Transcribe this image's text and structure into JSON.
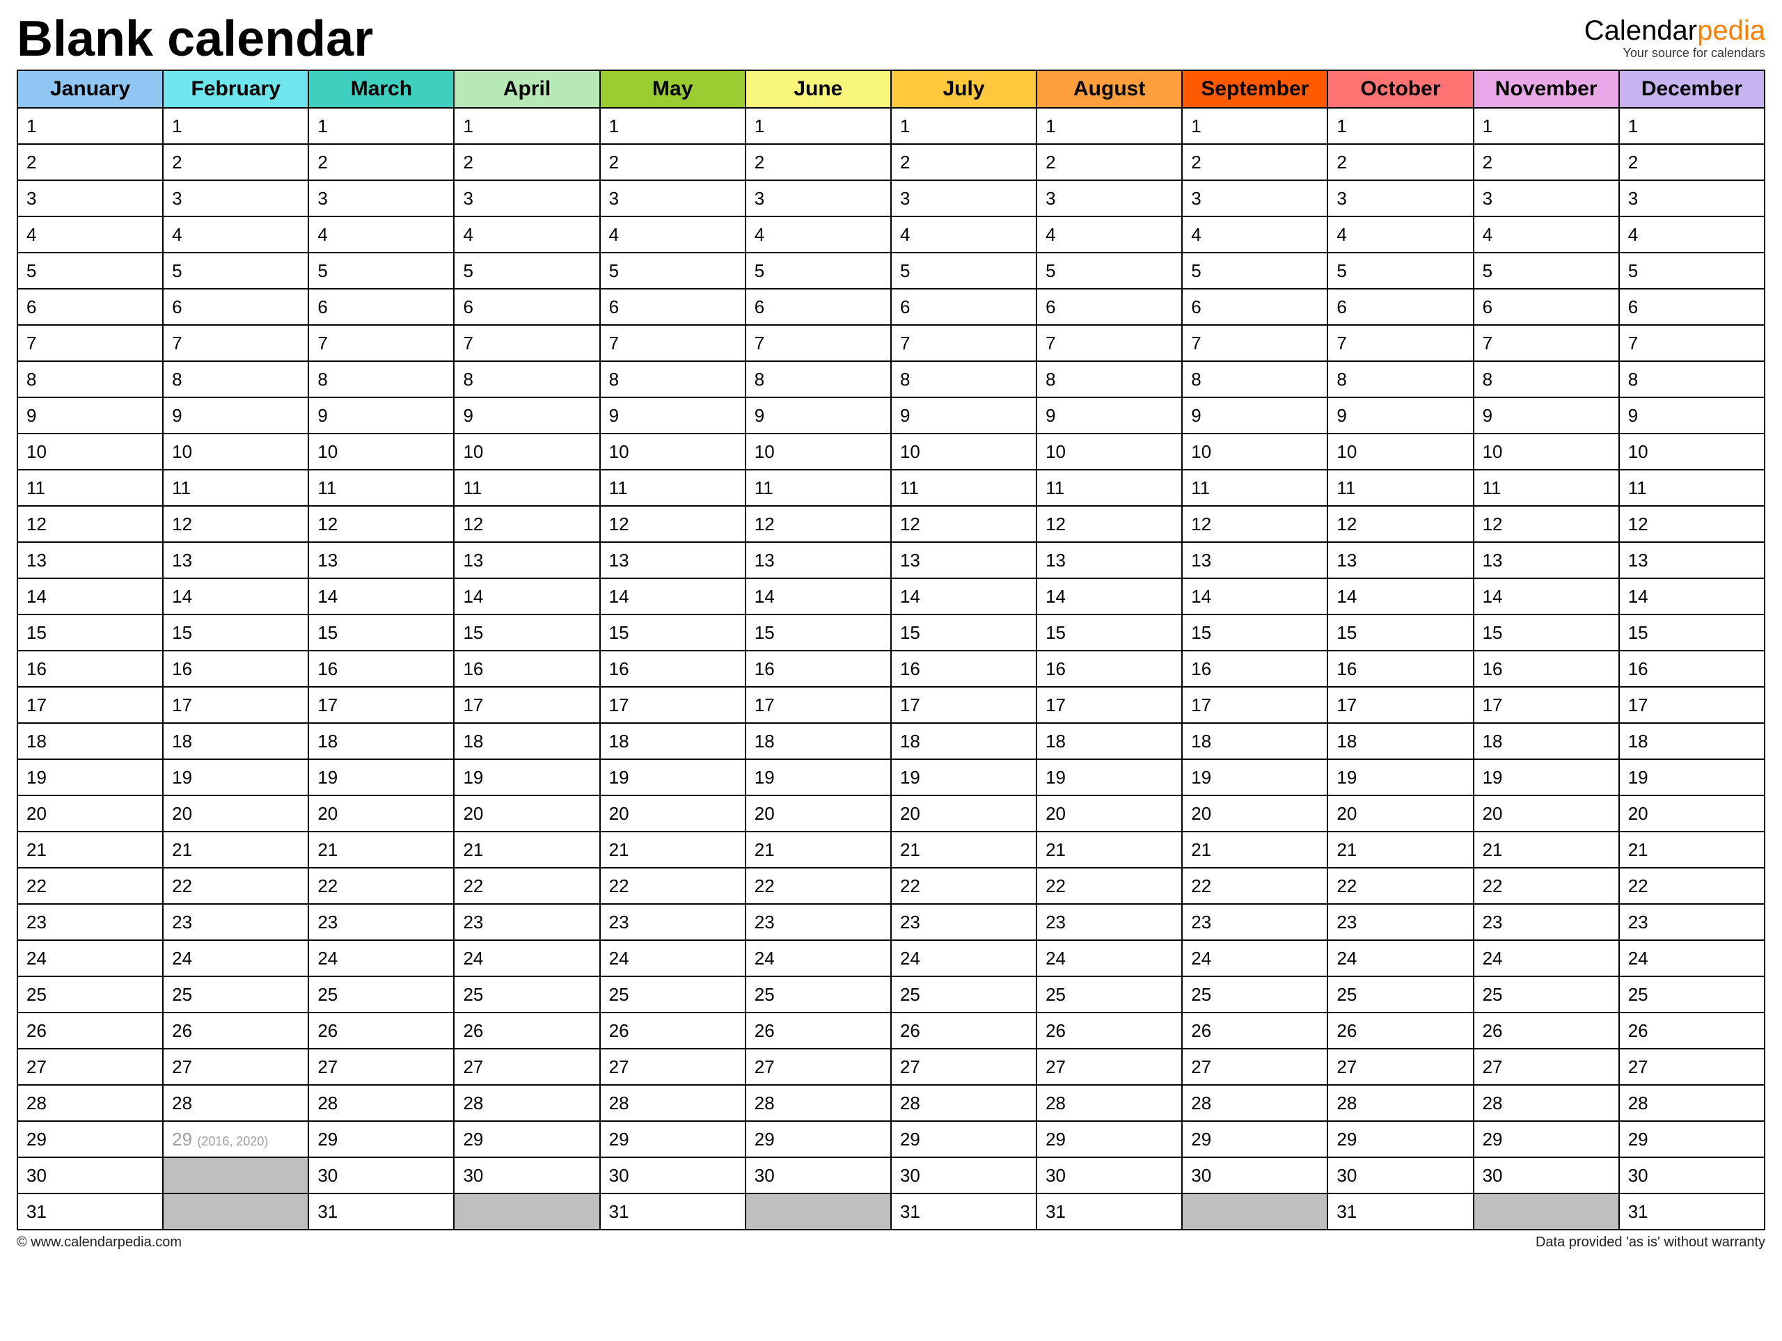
{
  "title": "Blank calendar",
  "brand": {
    "part1": "Calendar",
    "part2": "pedia",
    "tagline": "Your source for calendars"
  },
  "months": [
    {
      "name": "January",
      "color": "#8fc6f3",
      "days": 31
    },
    {
      "name": "February",
      "color": "#6fe5ee",
      "days": 29,
      "leap_day": 29,
      "leap_note": "(2016, 2020)"
    },
    {
      "name": "March",
      "color": "#3fcfbf",
      "days": 31
    },
    {
      "name": "April",
      "color": "#b7e9b7",
      "days": 30
    },
    {
      "name": "May",
      "color": "#9acd32",
      "days": 31
    },
    {
      "name": "June",
      "color": "#f7f57a",
      "days": 30
    },
    {
      "name": "July",
      "color": "#ffc83d",
      "days": 31
    },
    {
      "name": "August",
      "color": "#ff9e3d",
      "days": 31
    },
    {
      "name": "September",
      "color": "#ff5a00",
      "days": 30
    },
    {
      "name": "October",
      "color": "#ff7373",
      "days": 31
    },
    {
      "name": "November",
      "color": "#e9a9e9",
      "days": 30
    },
    {
      "name": "December",
      "color": "#c6b3f0",
      "days": 31
    }
  ],
  "max_rows": 31,
  "footer": {
    "left": "© www.calendarpedia.com",
    "right": "Data provided 'as is' without warranty"
  }
}
